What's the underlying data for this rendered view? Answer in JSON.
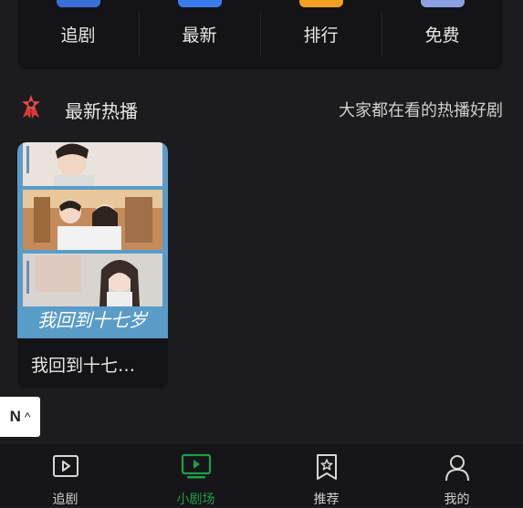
{
  "categories": [
    {
      "label": "追剧",
      "color": "#3a6fd8"
    },
    {
      "label": "最新",
      "color": "#3b7bf0"
    },
    {
      "label": "排行",
      "color": "#f0a020"
    },
    {
      "label": "免费",
      "color": "#8aa0e0"
    }
  ],
  "section": {
    "title": "最新热播",
    "subtitle": "大家都在看的热播好剧",
    "icon": "star-badge-icon",
    "icon_color": "#e84a4a"
  },
  "dramas": [
    {
      "title": "我回到十七…",
      "poster_text": "我回到十七岁"
    }
  ],
  "chip": {
    "label": "N",
    "icon": "chevron-up-icon"
  },
  "bottom_nav": [
    {
      "label": "追剧",
      "icon": "play-square-icon"
    },
    {
      "label": "小剧场",
      "icon": "tv-play-icon",
      "active": true
    },
    {
      "label": "推荐",
      "icon": "bookmark-star-icon"
    },
    {
      "label": "我的",
      "icon": "person-icon"
    }
  ],
  "colors": {
    "accent": "#1e9e4a",
    "background": "#1c1c1e"
  }
}
